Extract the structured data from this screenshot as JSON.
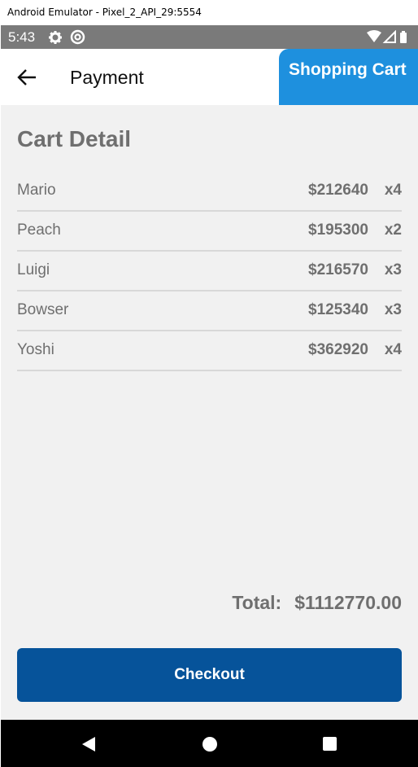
{
  "window": {
    "title": "Android Emulator - Pixel_2_API_29:5554"
  },
  "status_bar": {
    "time": "5:43",
    "icons": [
      "gear-icon",
      "at-sign-icon",
      "wifi-icon",
      "signal-icon",
      "battery-icon"
    ]
  },
  "app_bar": {
    "title": "Payment",
    "cart_tab_label": "Shopping Cart",
    "back_icon": "arrow-left-icon"
  },
  "cart": {
    "heading": "Cart Detail",
    "items": [
      {
        "name": "Mario",
        "price": "$212640",
        "qty": "x4"
      },
      {
        "name": "Peach",
        "price": "$195300",
        "qty": "x2"
      },
      {
        "name": "Luigi",
        "price": "$216570",
        "qty": "x3"
      },
      {
        "name": "Bowser",
        "price": "$125340",
        "qty": "x3"
      },
      {
        "name": "Yoshi",
        "price": "$362920",
        "qty": "x4"
      }
    ],
    "total_label": "Total:",
    "total_value": "$1112770.00",
    "checkout_label": "Checkout"
  },
  "colors": {
    "accent_tab": "#1e90de",
    "checkout_button": "#06539a",
    "background": "#f1f1f1",
    "text_muted": "#6f6f6f"
  },
  "nav_bar": {
    "icons": [
      "back-triangle-icon",
      "home-circle-icon",
      "recents-square-icon"
    ]
  }
}
